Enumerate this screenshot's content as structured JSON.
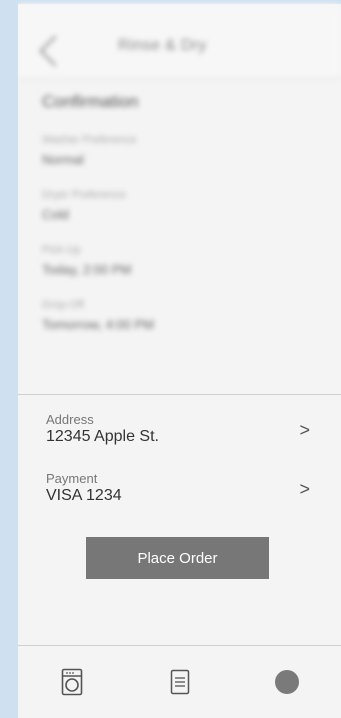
{
  "header": {
    "title": "Rinse & Dry"
  },
  "confirmation": {
    "title": "Confirmation",
    "fields": [
      {
        "label": "Washer Preference",
        "value": "Normal"
      },
      {
        "label": "Dryer Preference",
        "value": "Cold"
      },
      {
        "label": "Pick-Up",
        "value": "Today, 2:00 PM"
      },
      {
        "label": "Drop-Off",
        "value": "Tomorrow, 4:00 PM"
      }
    ]
  },
  "address": {
    "label": "Address",
    "value": "12345 Apple St."
  },
  "payment": {
    "label": "Payment",
    "value": "VISA 1234"
  },
  "actions": {
    "place_order": "Place Order"
  },
  "nav": {
    "items": [
      {
        "icon": "washing-machine-icon"
      },
      {
        "icon": "list-icon"
      },
      {
        "icon": "profile-circle-icon"
      }
    ]
  },
  "colors": {
    "background": "#cfe0f1",
    "button": "#777777"
  }
}
